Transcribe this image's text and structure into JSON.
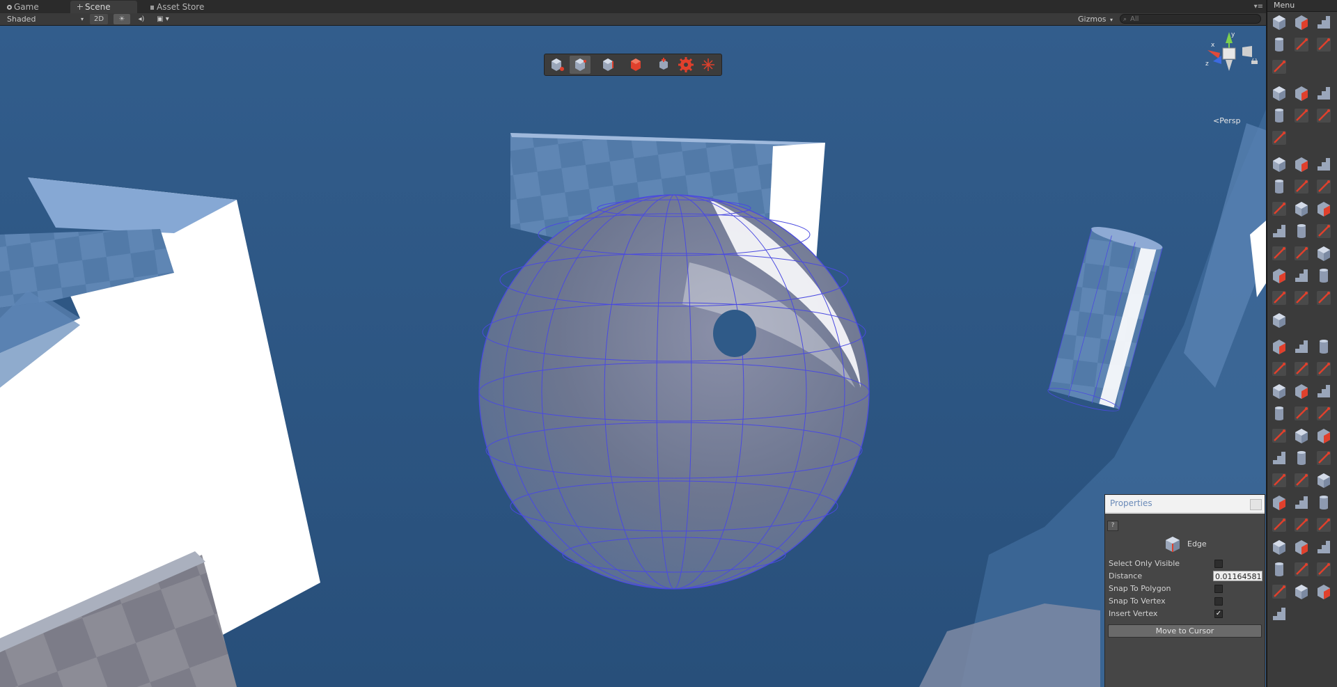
{
  "tabs": [
    {
      "label": "Game",
      "icon": "game-controller-icon"
    },
    {
      "label": "Scene",
      "icon": "scene-grid-icon"
    },
    {
      "label": "Asset Store",
      "icon": "lock-icon"
    }
  ],
  "toolbar": {
    "shading": "Shaded",
    "mode_2d": "2D",
    "gizmos": "Gizmos",
    "search_placeholder": "All"
  },
  "viewport": {
    "projection_label": "Persp",
    "axes": {
      "x": "x",
      "y": "y",
      "z": "z"
    }
  },
  "tool_strip": [
    {
      "icon": "object-mode-icon"
    },
    {
      "icon": "vertex-mode-icon",
      "active": true
    },
    {
      "icon": "edge-mode-icon"
    },
    {
      "icon": "face-mode-icon"
    },
    {
      "icon": "pivot-icon"
    },
    {
      "icon": "settings-gear-icon"
    },
    {
      "icon": "center-handle-icon"
    }
  ],
  "properties": {
    "title": "Properties",
    "help_label": "?",
    "mode": "Edge",
    "rows": [
      {
        "label": "Select Only Visible",
        "checked": false
      },
      {
        "label": "Distance",
        "value": "0.01164581"
      },
      {
        "label": "Snap To Polygon",
        "checked": false
      },
      {
        "label": "Snap To Vertex",
        "checked": false
      },
      {
        "label": "Insert Vertex",
        "checked": true
      }
    ],
    "move_button": "Move to Cursor"
  },
  "menu_panel": {
    "title": "Menu"
  },
  "colors": {
    "sky": "#2e5784",
    "wire": "#4a4ae0",
    "accent_red": "#e0402c"
  }
}
